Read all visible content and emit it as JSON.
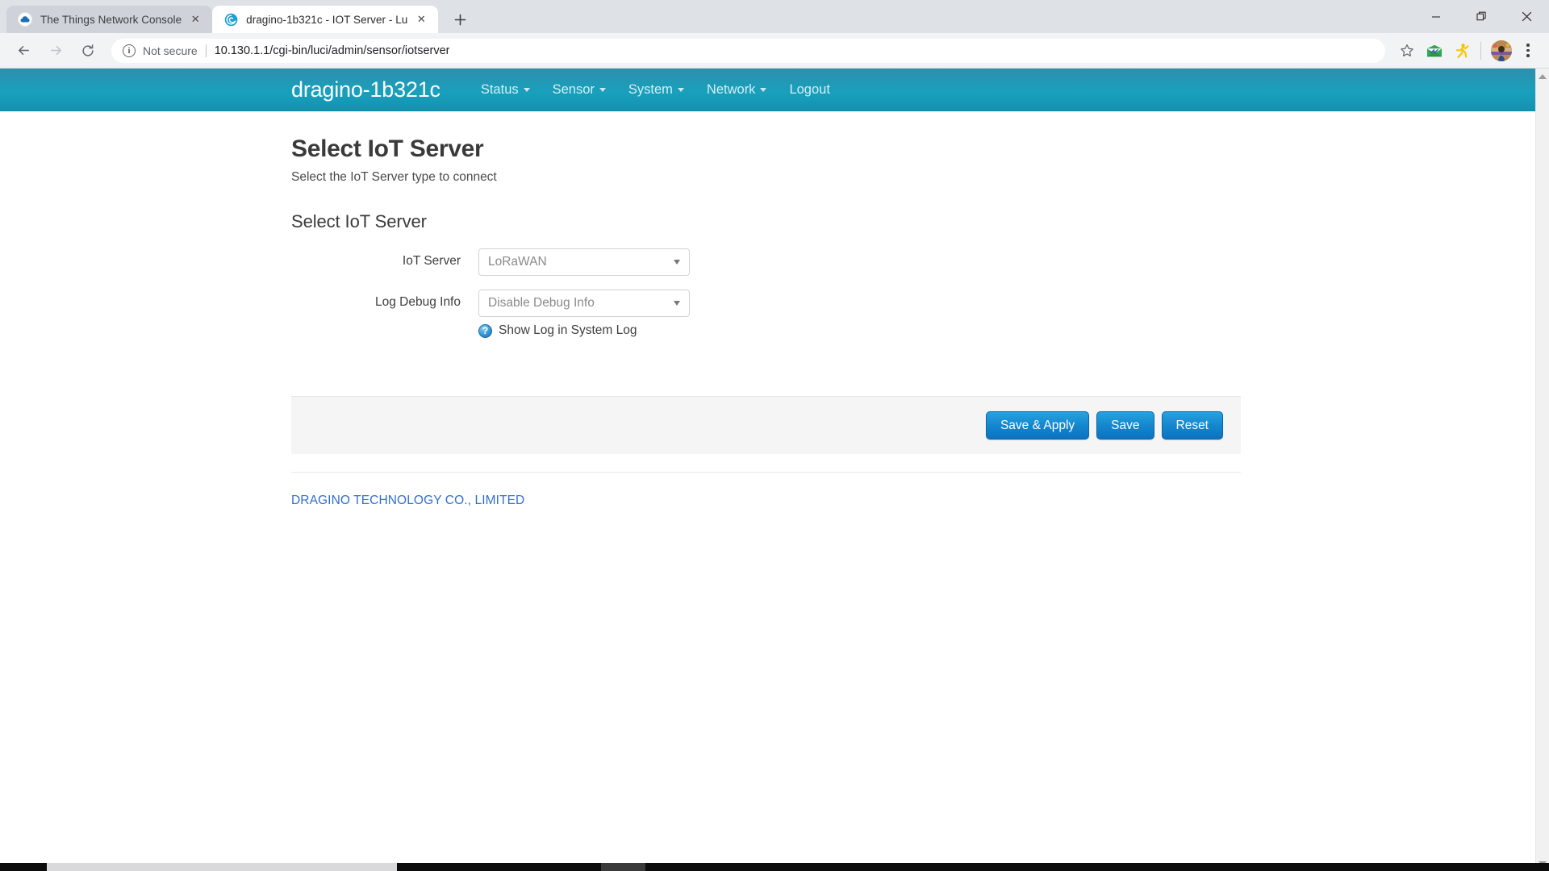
{
  "browser": {
    "tabs": [
      {
        "title": "The Things Network Console",
        "favicon": "cloud-icon",
        "active": false,
        "close_label": "✕"
      },
      {
        "title": "dragino-1b321c - IOT Server - Lu",
        "favicon": "dragino-swirl-icon",
        "active": true,
        "close_label": "✕"
      }
    ],
    "new_tab_label": "+",
    "window_controls": {
      "minimize": "—",
      "restore": "❐",
      "close": "✕"
    },
    "nav": {
      "back": "←",
      "forward": "→",
      "reload": "⟳"
    },
    "omnibox": {
      "info_glyph": "i",
      "security_text": "Not secure",
      "url_host": "10.130.1.1",
      "url_path": "/cgi-bin/luci/admin/sensor/iotserver"
    },
    "toolbar_icons": [
      "bookmark-star-icon",
      "mail-extension-icon",
      "yellow-extension-icon",
      "profile-avatar",
      "chrome-menu-icon"
    ]
  },
  "luci": {
    "brand": "dragino-1b321c",
    "nav_items": [
      {
        "label": "Status",
        "has_caret": true
      },
      {
        "label": "Sensor",
        "has_caret": true
      },
      {
        "label": "System",
        "has_caret": true
      },
      {
        "label": "Network",
        "has_caret": true
      },
      {
        "label": "Logout",
        "has_caret": false
      }
    ],
    "page_title": "Select IoT Server",
    "page_subtitle": "Select the IoT Server type to connect",
    "section_legend": "Select IoT Server",
    "fields": [
      {
        "label": "IoT Server",
        "value": "LoRaWAN",
        "type": "select"
      },
      {
        "label": "Log Debug Info",
        "value": "Disable Debug Info",
        "type": "select"
      }
    ],
    "help": {
      "icon_glyph": "?",
      "text": "Show Log in System Log"
    },
    "buttons": [
      {
        "label": "Save & Apply"
      },
      {
        "label": "Save"
      },
      {
        "label": "Reset"
      }
    ],
    "footer_link": "DRAGINO TECHNOLOGY CO., LIMITED"
  },
  "colors": {
    "navbar_accent": "#18a0bd",
    "button_blue": "#1285cd",
    "link_blue": "#2f6fd0"
  }
}
